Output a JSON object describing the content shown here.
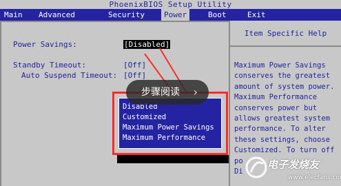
{
  "title": "PhoenixBIOS Setup Utility",
  "menu": [
    {
      "label": "Main",
      "active": false
    },
    {
      "label": "Advanced",
      "active": false
    },
    {
      "label": "Security",
      "active": false
    },
    {
      "label": "Power",
      "active": true
    },
    {
      "label": "Boot",
      "active": false
    },
    {
      "label": "Exit",
      "active": false
    }
  ],
  "settings": {
    "power_savings": {
      "label": "Power Savings:",
      "value": "Disabled"
    },
    "standby_timeout": {
      "label": "Standby Timeout:",
      "value": "[Off]"
    },
    "auto_suspend_timeout": {
      "label": "Auto Suspend Timeout:",
      "value": "[Off]"
    }
  },
  "help": {
    "title": "Item Specific Help",
    "text": "Maximum Power Savings\nconserves the greatest\namount of system power.\nMaximum Performance\nconserves power but\nallows greatest system\nperformance. To alter\nthese settings, choose\nCustomized. To turn off\npo\nDi"
  },
  "popup": {
    "options": [
      "Disabled",
      "Customized",
      "Maximum Power Savings",
      "Maximum Performance"
    ],
    "selected": "Disabled"
  },
  "overlay": {
    "label": "步骤阅读",
    "chevron": "›"
  },
  "watermark": {
    "brand": "电子发烧友",
    "url": "www.elecfans.com"
  },
  "colors": {
    "bios_blue": "#2424a2",
    "bios_gray": "#c8c8c8",
    "highlight": "#ff2a2a"
  }
}
